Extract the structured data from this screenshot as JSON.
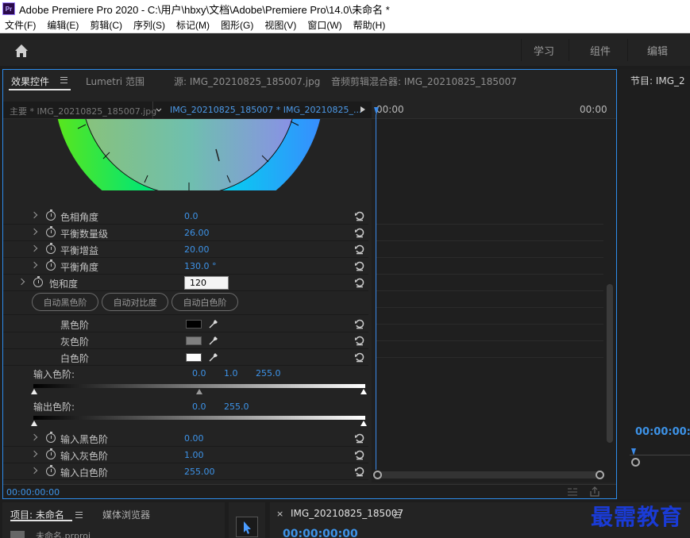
{
  "window": {
    "app_logo": "Pr",
    "title": "Adobe Premiere Pro 2020 - C:\\用户\\hbxy\\文档\\Adobe\\Premiere Pro\\14.0\\未命名 *"
  },
  "menu": [
    "文件(F)",
    "编辑(E)",
    "剪辑(C)",
    "序列(S)",
    "标记(M)",
    "图形(G)",
    "视图(V)",
    "窗口(W)",
    "帮助(H)"
  ],
  "workspace": {
    "tabs": [
      "学习",
      "组件",
      "编辑"
    ]
  },
  "effects_panel": {
    "tabs": [
      {
        "label": "效果控件",
        "active": true
      },
      {
        "label": "Lumetri 范围",
        "active": false
      },
      {
        "label": "源: IMG_20210825_185007.jpg",
        "active": false
      },
      {
        "label": "音频剪辑混合器: IMG_20210825_185007",
        "active": false
      }
    ],
    "clip_master": "主要 * IMG_20210825_185007.jpg",
    "clip_sequence": "IMG_20210825_185007 * IMG_20210825_...",
    "properties": [
      {
        "label": "色相角度",
        "value": "0.0"
      },
      {
        "label": "平衡数量级",
        "value": "26.00"
      },
      {
        "label": "平衡增益",
        "value": "20.00"
      },
      {
        "label": "平衡角度",
        "value": "130.0 °"
      }
    ],
    "saturation": {
      "label": "饱和度",
      "value": "120"
    },
    "auto_buttons": [
      "自动黑色阶",
      "自动对比度",
      "自动白色阶"
    ],
    "levels": [
      {
        "label": "黑色阶",
        "color": "#000000"
      },
      {
        "label": "灰色阶",
        "color": "#808080"
      },
      {
        "label": "白色阶",
        "color": "#ffffff"
      }
    ],
    "input_levels": {
      "label": "输入色阶:",
      "values": [
        "0.0",
        "1.0",
        "255.0"
      ]
    },
    "output_levels": {
      "label": "输出色阶:",
      "values": [
        "0.0",
        "255.0"
      ]
    },
    "bottom_props": [
      {
        "label": "输入黑色阶",
        "value": "0.00"
      },
      {
        "label": "输入灰色阶",
        "value": "1.00"
      },
      {
        "label": "输入白色阶",
        "value": "255.00"
      }
    ],
    "timeline_start": "00:00",
    "timeline_end": "00:00",
    "current_time": "00:00:00:00"
  },
  "program_panel": {
    "title": "节目: IMG_2",
    "timecode": "00:00:00:0"
  },
  "bottom": {
    "project_tab": "项目: 未命名",
    "media_browser_tab": "媒体浏览器",
    "project_item": "未命名.prproj",
    "timeline_tab": "IMG_20210825_185007",
    "timeline_time": "00:00:00:00"
  },
  "watermark": "最需教育",
  "colors": {
    "accent": "#2d8ceb",
    "value_blue": "#3d93e8",
    "panel_bg": "#232323"
  }
}
